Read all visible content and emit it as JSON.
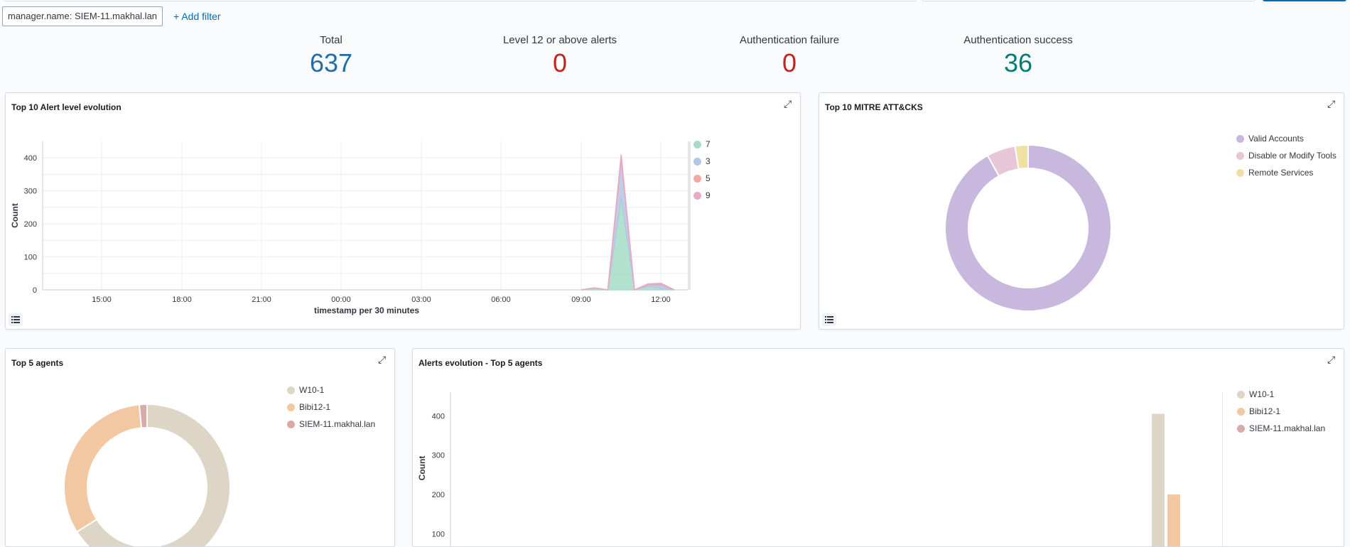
{
  "filter": {
    "pill": "manager.name: SIEM-11.makhal.lan",
    "add_label": "+ Add filter"
  },
  "metrics": [
    {
      "label": "Total",
      "value": "637",
      "color": "#1f6ea8"
    },
    {
      "label": "Level 12 or above alerts",
      "value": "0",
      "color": "#bd271e"
    },
    {
      "label": "Authentication failure",
      "value": "0",
      "color": "#bd271e"
    },
    {
      "label": "Authentication success",
      "value": "36",
      "color": "#017d73"
    }
  ],
  "panels": {
    "alert_level": {
      "title": "Top 10 Alert level evolution",
      "ylabel": "Count",
      "xlabel": "timestamp per 30 minutes"
    },
    "mitre": {
      "title": "Top 10 MITRE ATT&CKS"
    },
    "agents": {
      "title": "Top 5 agents"
    },
    "alerts_evolution": {
      "title": "Alerts evolution - Top 5 agents",
      "ylabel": "Count"
    }
  },
  "chart_data": [
    {
      "type": "area",
      "title": "Top 10 Alert level evolution",
      "xlabel": "timestamp per 30 minutes",
      "ylabel": "Count",
      "ylim": [
        0,
        450
      ],
      "y_ticks": [
        0,
        100,
        200,
        300,
        400
      ],
      "x_tick_labels": [
        "15:00",
        "18:00",
        "21:00",
        "00:00",
        "03:00",
        "06:00",
        "09:00",
        "12:00"
      ],
      "x": [
        "09:00",
        "09:30",
        "10:00",
        "10:30",
        "11:00",
        "11:30",
        "12:00",
        "12:30"
      ],
      "series": [
        {
          "name": "7",
          "color": "#a6dcc7",
          "values": [
            0,
            5,
            0,
            280,
            0,
            10,
            5,
            0
          ]
        },
        {
          "name": "3",
          "color": "#b4c6e3",
          "values": [
            0,
            1,
            0,
            115,
            0,
            5,
            10,
            0
          ]
        },
        {
          "name": "5",
          "color": "#f1a9a1",
          "values": [
            0,
            0,
            0,
            5,
            0,
            1,
            2,
            0
          ]
        },
        {
          "name": "9",
          "color": "#e7a9c4",
          "values": [
            0,
            0,
            0,
            10,
            0,
            2,
            3,
            0
          ]
        }
      ],
      "legend": "right"
    },
    {
      "type": "pie",
      "title": "Top 10 MITRE ATT&CKS",
      "donut": true,
      "slices": [
        {
          "name": "Valid Accounts",
          "value": 90.5,
          "color": "#c8b8de"
        },
        {
          "name": "Disable or Modify Tools",
          "value": 5.5,
          "color": "#e6c6d7"
        },
        {
          "name": "Remote Services",
          "value": 2.5,
          "color": "#efe1a5"
        }
      ],
      "legend": "right"
    },
    {
      "type": "pie",
      "title": "Top 5 agents",
      "donut": true,
      "slices": [
        {
          "name": "W10-1",
          "value": 66,
          "color": "#ddd5c6"
        },
        {
          "name": "Bibi12-1",
          "value": 32.5,
          "color": "#f1c8a2"
        },
        {
          "name": "SIEM-11.makhal.lan",
          "value": 1.5,
          "color": "#d8aba9"
        }
      ],
      "legend": "right"
    },
    {
      "type": "bar",
      "title": "Alerts evolution - Top 5 agents",
      "ylabel": "Count",
      "ylim": [
        0,
        460
      ],
      "y_ticks": [
        100,
        200,
        300,
        400
      ],
      "series": [
        {
          "name": "W10-1",
          "color": "#ddd5c6",
          "values": [
            405
          ]
        },
        {
          "name": "Bibi12-1",
          "color": "#f1c8a2",
          "values": [
            200
          ]
        },
        {
          "name": "SIEM-11.makhal.lan",
          "color": "#d8aba9",
          "values": [
            0
          ]
        }
      ],
      "legend": "right"
    }
  ]
}
